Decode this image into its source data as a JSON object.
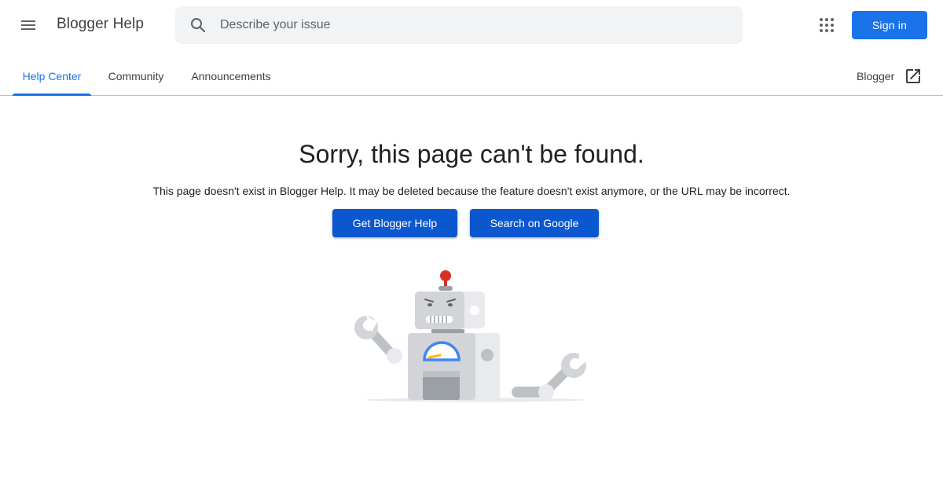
{
  "header": {
    "app_title": "Blogger Help",
    "menu_icon": "hamburger-menu-icon",
    "search": {
      "placeholder": "Describe your issue",
      "value": "",
      "icon": "search-icon"
    },
    "apps_icon": "google-apps-grid-icon",
    "sign_in_label": "Sign in"
  },
  "tabs": [
    {
      "label": "Help Center",
      "active": true
    },
    {
      "label": "Community",
      "active": false
    },
    {
      "label": "Announcements",
      "active": false
    }
  ],
  "external_link": {
    "label": "Blogger",
    "icon": "open-in-new-icon"
  },
  "error": {
    "title": "Sorry, this page can't be found.",
    "message": "This page doesn't exist in Blogger Help. It may be deleted because the feature doesn't exist anymore, or the URL may be incorrect.",
    "primary_button": "Get Blogger Help",
    "secondary_button": "Search on Google"
  },
  "colors": {
    "accent": "#1a73e8",
    "button_blue": "#0b57d0",
    "robot_gray": "#d2d4d8",
    "robot_dark": "#9aa0a6",
    "antenna_red": "#d93025"
  }
}
